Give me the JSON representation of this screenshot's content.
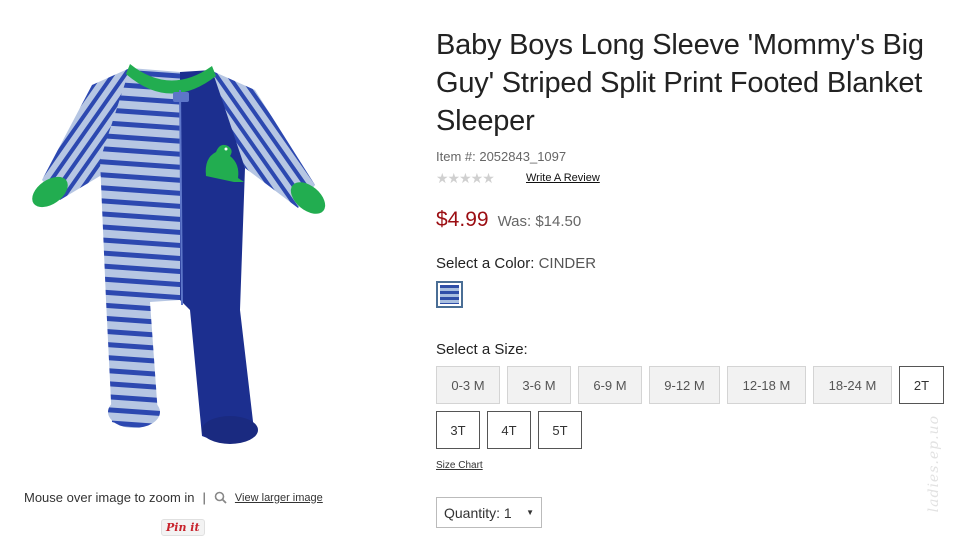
{
  "product": {
    "title": "Baby Boys Long Sleeve 'Mommy's Big Guy' Striped Split Print Footed Blanket Sleeper",
    "item_number": "Item #: 2052843_1097",
    "rating_stars": "★★★★★",
    "write_review": "Write A Review",
    "price_now": "$4.99",
    "price_was": "Was: $14.50"
  },
  "color": {
    "label": "Select a Color:",
    "value": "CINDER",
    "swatch_icon": "striped-swatch"
  },
  "size": {
    "label": "Select a Size:",
    "options": [
      {
        "label": "0-3 M",
        "available": false
      },
      {
        "label": "3-6 M",
        "available": false
      },
      {
        "label": "6-9 M",
        "available": false
      },
      {
        "label": "9-12 M",
        "available": false
      },
      {
        "label": "12-18 M",
        "available": false
      },
      {
        "label": "18-24 M",
        "available": false
      },
      {
        "label": "2T",
        "available": true
      },
      {
        "label": "3T",
        "available": true
      },
      {
        "label": "4T",
        "available": true
      },
      {
        "label": "5T",
        "available": true
      }
    ],
    "chart_link": "Size Chart"
  },
  "quantity": {
    "label": "Quantity:",
    "value": "1"
  },
  "image_area": {
    "zoom_hint": "Mouse over image to zoom in",
    "separator": "|",
    "larger_link": "View larger image",
    "pin_it": "Pin it"
  },
  "watermark": "ladies.ep.uo",
  "colors": {
    "sale_price": "#9b0d12",
    "onesie_stripe": "#2f4fa8",
    "onesie_light": "#a9bfe0",
    "onesie_trim": "#1fa84a",
    "onesie_navy": "#1c2f8f"
  }
}
